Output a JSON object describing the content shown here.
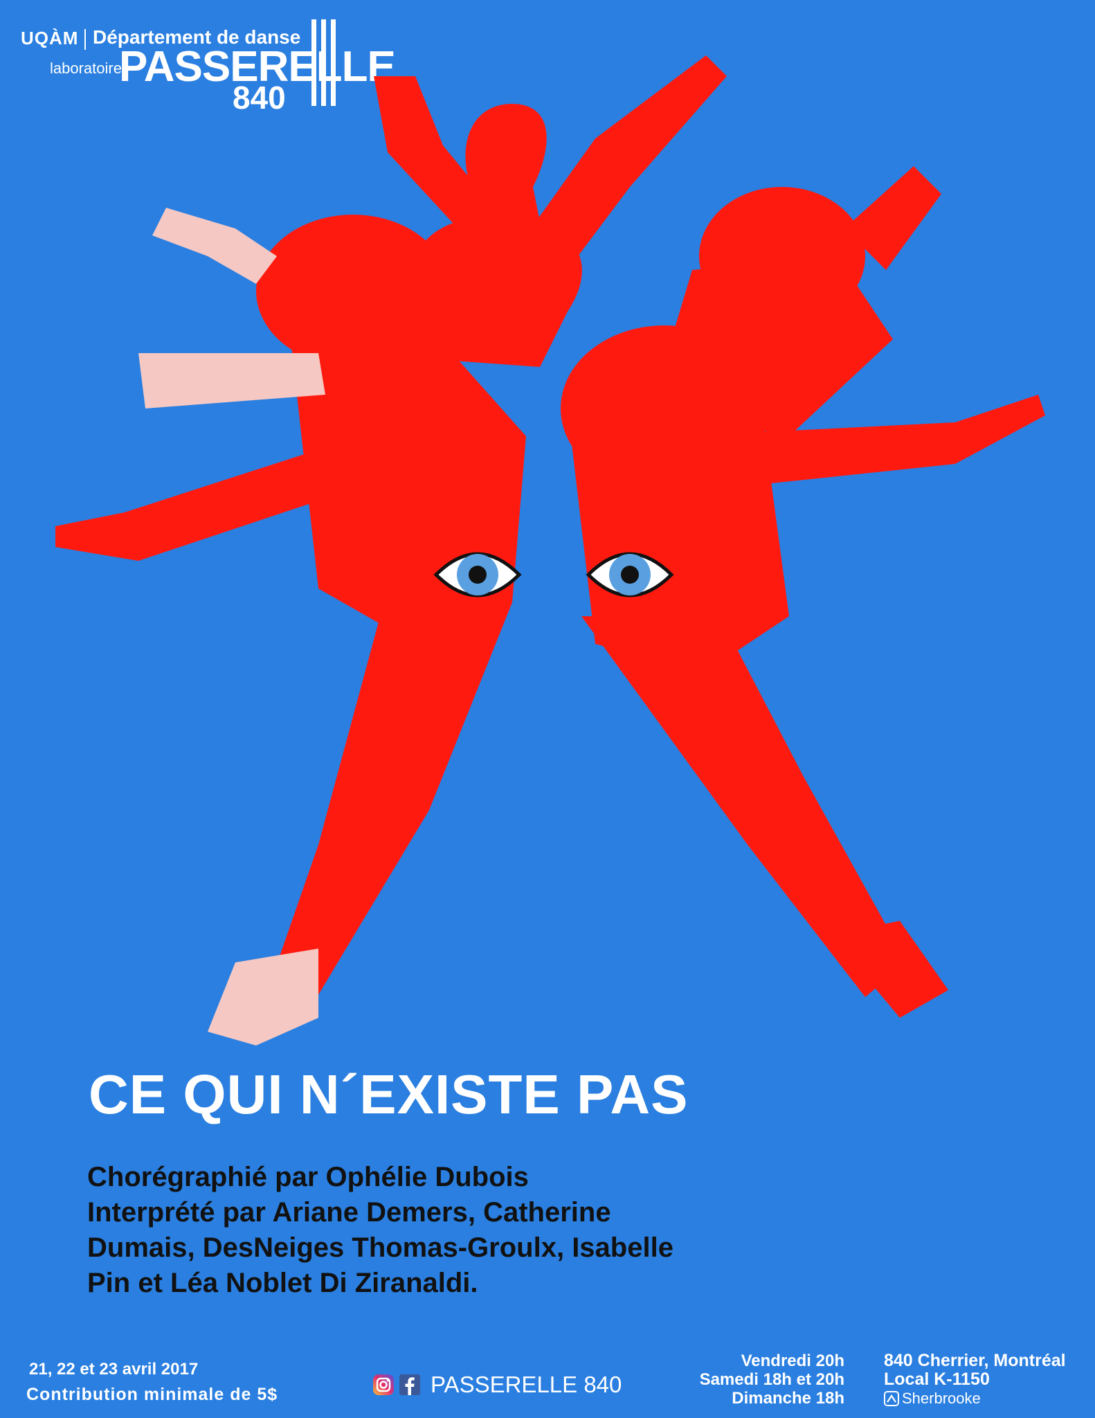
{
  "logo": {
    "uqam": "UQÀM",
    "department": "Département de danse",
    "laboratoire": "laboratoire",
    "passerelle": "PASSERELLE",
    "number": "840"
  },
  "artwork": {
    "colors": {
      "background": "#2a7fe0",
      "figures": "#ff1a10",
      "figures_light": "#f5c8c3",
      "eye_iris": "#5aa0e0"
    }
  },
  "show": {
    "title": "CE QUI N´EXISTE PAS",
    "credits": [
      "Chorégraphié par Ophélie Dubois",
      "Interprété par Ariane Demers, Catherine",
      "Dumais, DesNeiges Thomas-Groulx, Isabelle",
      "Pin et Léa Noblet Di Ziranaldi."
    ]
  },
  "footer": {
    "dates": "21, 22 et 23 avril 2017",
    "contribution": "Contribution minimale de 5$",
    "social_icons": [
      "instagram-icon",
      "facebook-icon"
    ],
    "social_name": "PASSERELLE 840",
    "times": [
      "Vendredi 20h",
      "Samedi 18h et 20h",
      "Dimanche 18h"
    ],
    "address_line1": "840 Cherrier, Montréal",
    "address_line2": "Local K-1150",
    "metro": "Sherbrooke"
  }
}
